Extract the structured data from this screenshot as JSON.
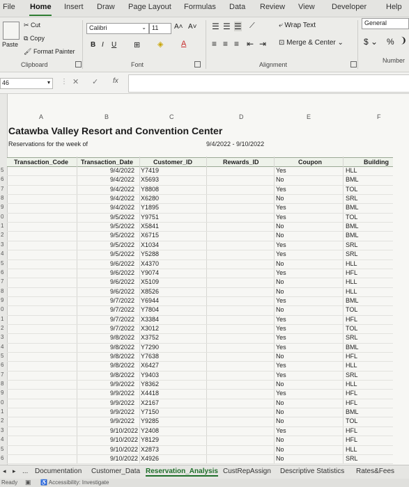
{
  "menu": [
    "File",
    "Home",
    "Insert",
    "Draw",
    "Page Layout",
    "Formulas",
    "Data",
    "Review",
    "View",
    "Developer",
    "Help"
  ],
  "ribbon": {
    "paste": "Paste",
    "cut": "Cut",
    "copy": "Copy",
    "format_painter": "Format Painter",
    "clipboard": "Clipboard",
    "font_name": "Calibri",
    "font_size": "11",
    "font_group": "Font",
    "wrap_text": "Wrap Text",
    "merge_center": "Merge & Center",
    "alignment_group": "Alignment",
    "number_format": "General",
    "number_group": "Number",
    "currency": "$",
    "percent": "%"
  },
  "formula_bar": {
    "cell_ref": "46",
    "fx": "fx",
    "value": ""
  },
  "sheet": {
    "title": "Catawba Valley Resort and Convention Center",
    "subtitle": "Reservations for the week of",
    "date_range": "9/4/2022 - 9/10/2022",
    "columns": [
      "A",
      "B",
      "C",
      "D",
      "E",
      "F"
    ],
    "headers": [
      "Transaction_Code",
      "Transaction_Date",
      "Customer_ID",
      "Rewards_ID",
      "Coupon",
      "Building"
    ],
    "row_numbers": [
      "5",
      "6",
      "7",
      "8",
      "9",
      "0",
      "1",
      "2",
      "3",
      "4",
      "5",
      "6",
      "7",
      "8",
      "9",
      "0",
      "1",
      "2",
      "3",
      "4",
      "5",
      "6",
      "7",
      "8",
      "9",
      "0",
      "1",
      "2",
      "3",
      "4",
      "5",
      "6"
    ],
    "rows": [
      [
        "9/4/2022",
        "Y7419",
        "Yes",
        "HLL"
      ],
      [
        "9/4/2022",
        "X5693",
        "No",
        "BML"
      ],
      [
        "9/4/2022",
        "Y8808",
        "Yes",
        "TOL"
      ],
      [
        "9/4/2022",
        "X6280",
        "No",
        "SRL"
      ],
      [
        "9/4/2022",
        "Y1895",
        "Yes",
        "BML"
      ],
      [
        "9/5/2022",
        "Y9751",
        "Yes",
        "TOL"
      ],
      [
        "9/5/2022",
        "X5841",
        "No",
        "BML"
      ],
      [
        "9/5/2022",
        "X6715",
        "No",
        "BML"
      ],
      [
        "9/5/2022",
        "X1034",
        "Yes",
        "SRL"
      ],
      [
        "9/5/2022",
        "Y5288",
        "Yes",
        "SRL"
      ],
      [
        "9/6/2022",
        "X4370",
        "No",
        "HLL"
      ],
      [
        "9/6/2022",
        "Y9074",
        "Yes",
        "HFL"
      ],
      [
        "9/6/2022",
        "X5109",
        "No",
        "HLL"
      ],
      [
        "9/6/2022",
        "X8526",
        "No",
        "HLL"
      ],
      [
        "9/7/2022",
        "Y6944",
        "Yes",
        "BML"
      ],
      [
        "9/7/2022",
        "Y7804",
        "No",
        "TOL"
      ],
      [
        "9/7/2022",
        "X3384",
        "Yes",
        "HFL"
      ],
      [
        "9/7/2022",
        "X3012",
        "Yes",
        "TOL"
      ],
      [
        "9/8/2022",
        "X3752",
        "Yes",
        "SRL"
      ],
      [
        "9/8/2022",
        "Y7290",
        "Yes",
        "BML"
      ],
      [
        "9/8/2022",
        "Y7638",
        "No",
        "HFL"
      ],
      [
        "9/8/2022",
        "X6427",
        "Yes",
        "HLL"
      ],
      [
        "9/8/2022",
        "Y9403",
        "Yes",
        "SRL"
      ],
      [
        "9/9/2022",
        "Y8362",
        "No",
        "HLL"
      ],
      [
        "9/9/2022",
        "X4418",
        "Yes",
        "HFL"
      ],
      [
        "9/9/2022",
        "X2167",
        "No",
        "HFL"
      ],
      [
        "9/9/2022",
        "Y7150",
        "No",
        "BML"
      ],
      [
        "9/9/2022",
        "Y9285",
        "No",
        "TOL"
      ],
      [
        "9/10/2022",
        "Y2408",
        "Yes",
        "HFL"
      ],
      [
        "9/10/2022",
        "Y8129",
        "No",
        "HFL"
      ],
      [
        "9/10/2022",
        "X2873",
        "No",
        "HLL"
      ],
      [
        "9/10/2022",
        "X4926",
        "No",
        "SRL"
      ]
    ]
  },
  "tabs": [
    "...",
    "Documentation",
    "Customer_Data",
    "Reservation_Analysis",
    "CustRepAssign",
    "Descriptive Statistics",
    "Rates&Fees"
  ],
  "active_tab": "Reservation_Analysis",
  "status": {
    "ready": "Ready",
    "accessibility": "Accessibility: Investigate"
  },
  "colors": {
    "accent": "#1f6f2a",
    "grid_bg": "#f7f7f4",
    "ribbon_bg": "#ecece9"
  }
}
